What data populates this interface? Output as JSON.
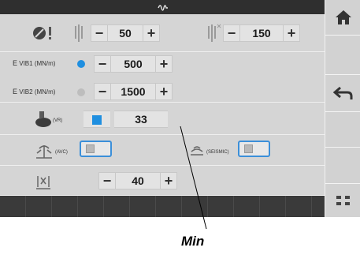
{
  "row1": {
    "left_value": "50",
    "right_value": "150"
  },
  "row2": {
    "e_vib1": {
      "label_e": "E",
      "label_sub": "VIB1 (MN/m)",
      "value": "500",
      "selected": true
    },
    "e_vib2": {
      "label_e": "E",
      "label_sub": "VIB2 (MN/m)",
      "value": "1500",
      "selected": false
    }
  },
  "row3": {
    "unit": "(VR)",
    "value": "33"
  },
  "row4": {
    "avc_label": "(AVC)",
    "seismic_label": "(SEISMIC)"
  },
  "row5": {
    "value": "40"
  },
  "buttons": {
    "minus": "−",
    "plus": "+"
  },
  "annotation": {
    "text": "Min"
  },
  "colors": {
    "accent": "#1f8fe0",
    "dark_bar": "#2f2f2f",
    "panel": "#d5d5d5"
  }
}
